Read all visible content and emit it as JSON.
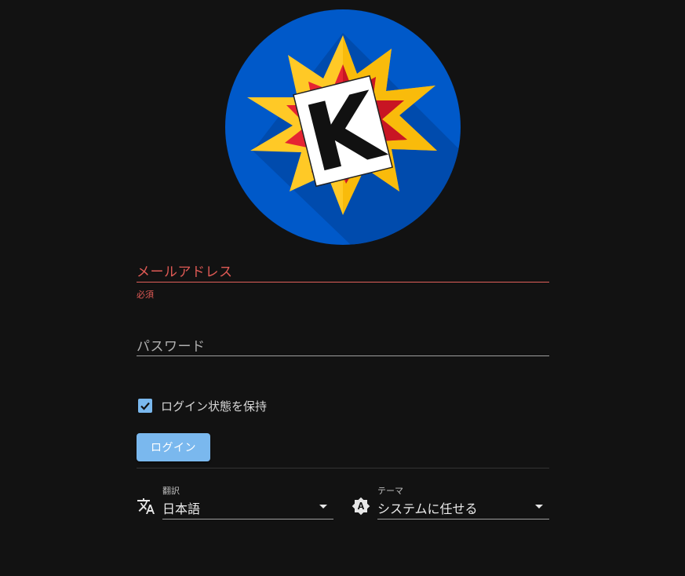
{
  "login": {
    "email": {
      "label": "メールアドレス",
      "value": "",
      "error": "必須"
    },
    "password": {
      "label": "パスワード",
      "value": ""
    },
    "remember": {
      "label": "ログイン状態を保持",
      "checked": true
    },
    "submit_label": "ログイン"
  },
  "settings": {
    "language": {
      "caption": "翻訳",
      "value": "日本語",
      "icon": "translate-icon"
    },
    "theme": {
      "caption": "テーマ",
      "value": "システムに任せる",
      "icon": "brightness-auto-icon"
    }
  },
  "logo": {
    "letter": "K",
    "colors": {
      "circle": "#0059c9",
      "burst_outer": "#ffc926",
      "burst_inner": "#d91a2a",
      "letter_bg": "#ffffff"
    }
  },
  "colors": {
    "background": "#121212",
    "accent": "#7ab8ee",
    "error": "#e05a55"
  }
}
